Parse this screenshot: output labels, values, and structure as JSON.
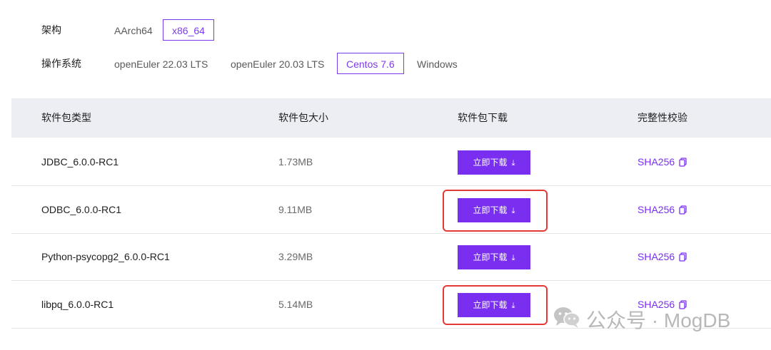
{
  "filters": {
    "arch": {
      "label": "架构",
      "options": [
        "AArch64",
        "x86_64"
      ],
      "selected": "x86_64"
    },
    "os": {
      "label": "操作系统",
      "options": [
        "openEuler 22.03 LTS",
        "openEuler 20.03 LTS",
        "Centos 7.6",
        "Windows"
      ],
      "selected": "Centos 7.6"
    }
  },
  "table": {
    "headers": {
      "type": "软件包类型",
      "size": "软件包大小",
      "download": "软件包下载",
      "checksum": "完整性校验"
    },
    "rows": [
      {
        "name": "JDBC_6.0.0-RC1",
        "size": "1.73MB",
        "download_label": "立即下载",
        "checksum": "SHA256",
        "highlighted": false
      },
      {
        "name": "ODBC_6.0.0-RC1",
        "size": "9.11MB",
        "download_label": "立即下载",
        "checksum": "SHA256",
        "highlighted": true
      },
      {
        "name": "Python-psycopg2_6.0.0-RC1",
        "size": "3.29MB",
        "download_label": "立即下载",
        "checksum": "SHA256",
        "highlighted": false
      },
      {
        "name": "libpq_6.0.0-RC1",
        "size": "5.14MB",
        "download_label": "立即下载",
        "checksum": "SHA256",
        "highlighted": true
      }
    ]
  },
  "watermark": {
    "text": "公众号 · MogDB",
    "icon": "wechat-icon"
  },
  "colors": {
    "accent": "#7a2ff0",
    "highlight": "#e53935",
    "header_bg": "#eceef4"
  }
}
